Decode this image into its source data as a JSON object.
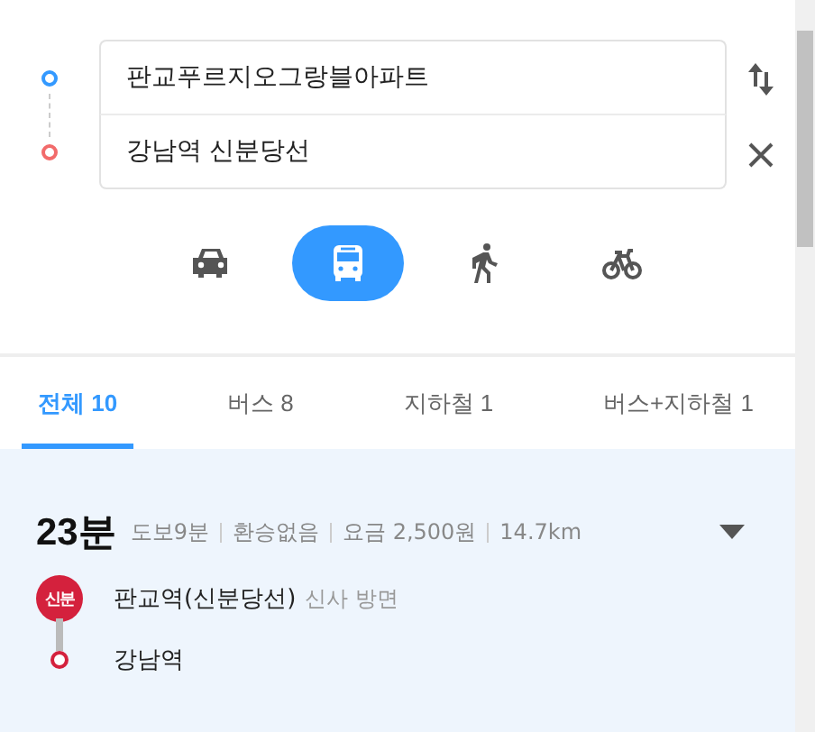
{
  "route": {
    "origin": "판교푸르지오그랑블아파트",
    "destination": "강남역 신분당선"
  },
  "modes": [
    {
      "kind": "car",
      "selected": false
    },
    {
      "kind": "bus",
      "selected": true
    },
    {
      "kind": "walk",
      "selected": false
    },
    {
      "kind": "bike",
      "selected": false
    }
  ],
  "tabs": [
    {
      "label": "전체 10",
      "selected": true
    },
    {
      "label": "버스 8",
      "selected": false
    },
    {
      "label": "지하철 1",
      "selected": false
    },
    {
      "label": "버스+지하철 1",
      "selected": false
    }
  ],
  "result": {
    "time": "23분",
    "details": [
      "도보9분",
      "환승없음",
      "요금 2,500원",
      "14.7km"
    ],
    "line_badge": "신분",
    "stops": [
      {
        "name": "판교역(신분당선)",
        "direction": "신사 방면"
      },
      {
        "name": "강남역"
      }
    ]
  }
}
